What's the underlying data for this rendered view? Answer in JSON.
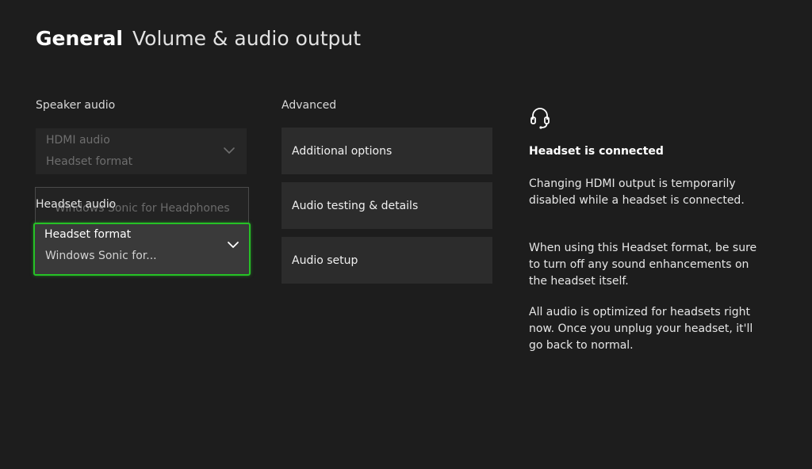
{
  "header": {
    "section": "General",
    "page": "Volume & audio output"
  },
  "speaker_audio": {
    "label": "Speaker audio",
    "dropdown_title": "HDMI audio",
    "dropdown_value": "Headset format"
  },
  "headset_audio": {
    "label": "Headset audio",
    "popup_option": "Windows Sonic for Headphones",
    "dropdown_title": "Headset format",
    "dropdown_value": "Windows Sonic for..."
  },
  "advanced": {
    "label": "Advanced",
    "buttons": [
      "Additional options",
      "Audio testing & details",
      "Audio setup"
    ]
  },
  "info": {
    "icon": "headset-icon",
    "headline": "Headset is connected",
    "paragraphs": [
      "Changing HDMI output is temporarily disabled while a headset is connected.",
      "When using this Headset format, be sure to turn off any sound enhancements on the headset itself.",
      "All audio is optimized for headsets right now. Once you unplug your headset, it'll go back to normal."
    ]
  },
  "colors": {
    "background": "#1d1d1d",
    "focus": "#26c226",
    "button": "#2c2c2c"
  }
}
